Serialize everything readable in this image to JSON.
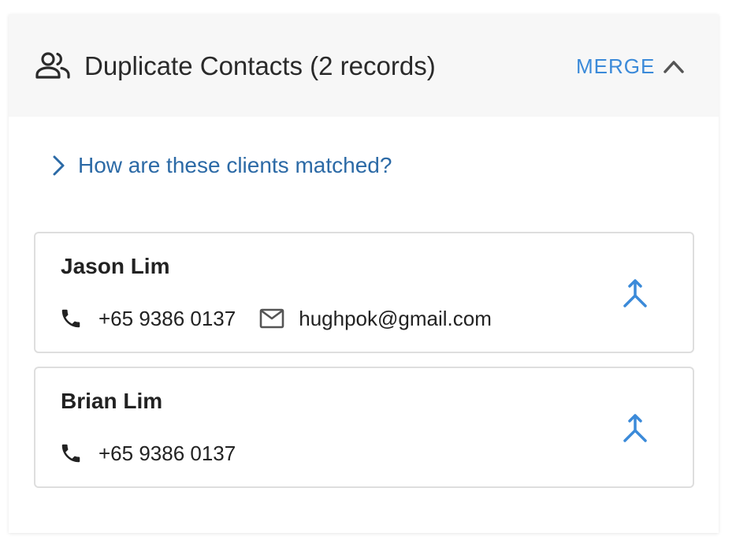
{
  "header": {
    "icon": "people-icon",
    "title": "Duplicate Contacts (2 records)",
    "merge_label": "MERGE",
    "collapse_icon": "chevron-up-icon"
  },
  "match_link": {
    "icon": "chevron-right-icon",
    "label": "How are these clients matched?"
  },
  "records": [
    {
      "name": "Jason Lim",
      "phone": "+65 9386 0137",
      "email": "hughpok@gmail.com",
      "merge_icon": "merge-icon"
    },
    {
      "name": "Brian Lim",
      "phone": "+65 9386 0137",
      "merge_icon": "merge-icon"
    }
  ],
  "colors": {
    "accent": "#3b8ad9",
    "link": "#2c6aa6",
    "header_bg": "#f7f7f7",
    "border": "#dedede"
  }
}
